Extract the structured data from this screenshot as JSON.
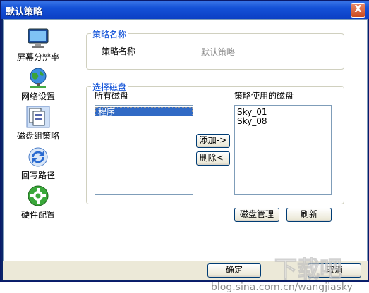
{
  "window": {
    "title": "默认策略",
    "close_glyph": "X"
  },
  "nav": {
    "items": [
      {
        "label": "屏幕分辨率",
        "icon": "monitor-icon"
      },
      {
        "label": "网络设置",
        "icon": "network-globe-icon"
      },
      {
        "label": "磁盘组策略",
        "icon": "disk-group-icon"
      },
      {
        "label": "回写路径",
        "icon": "writeback-arrows-icon"
      },
      {
        "label": "硬件配置",
        "icon": "hardware-gear-icon"
      }
    ]
  },
  "policy_name": {
    "group_title": "策略名称",
    "label": "策略名称",
    "value": "默认策略"
  },
  "disk_select": {
    "group_title": "选择磁盘",
    "all_disks_label": "所有磁盘",
    "used_disks_label": "策略使用的磁盘",
    "all_disks": [
      "程序"
    ],
    "used_disks": [
      "Sky_01",
      "Sky_08"
    ],
    "add_label": "添加->",
    "remove_label": "删除<-",
    "manage_label": "磁盘管理",
    "refresh_label": "刷新"
  },
  "footer": {
    "ok_label": "确定",
    "cancel_label": "取消"
  },
  "watermark": {
    "logo": "下载吧",
    "text": "blog.sina.com.cn/wangjiasky"
  },
  "colors": {
    "titlebar": "#0b3fc4",
    "legend": "#0046d5",
    "selection": "#316ac5"
  }
}
